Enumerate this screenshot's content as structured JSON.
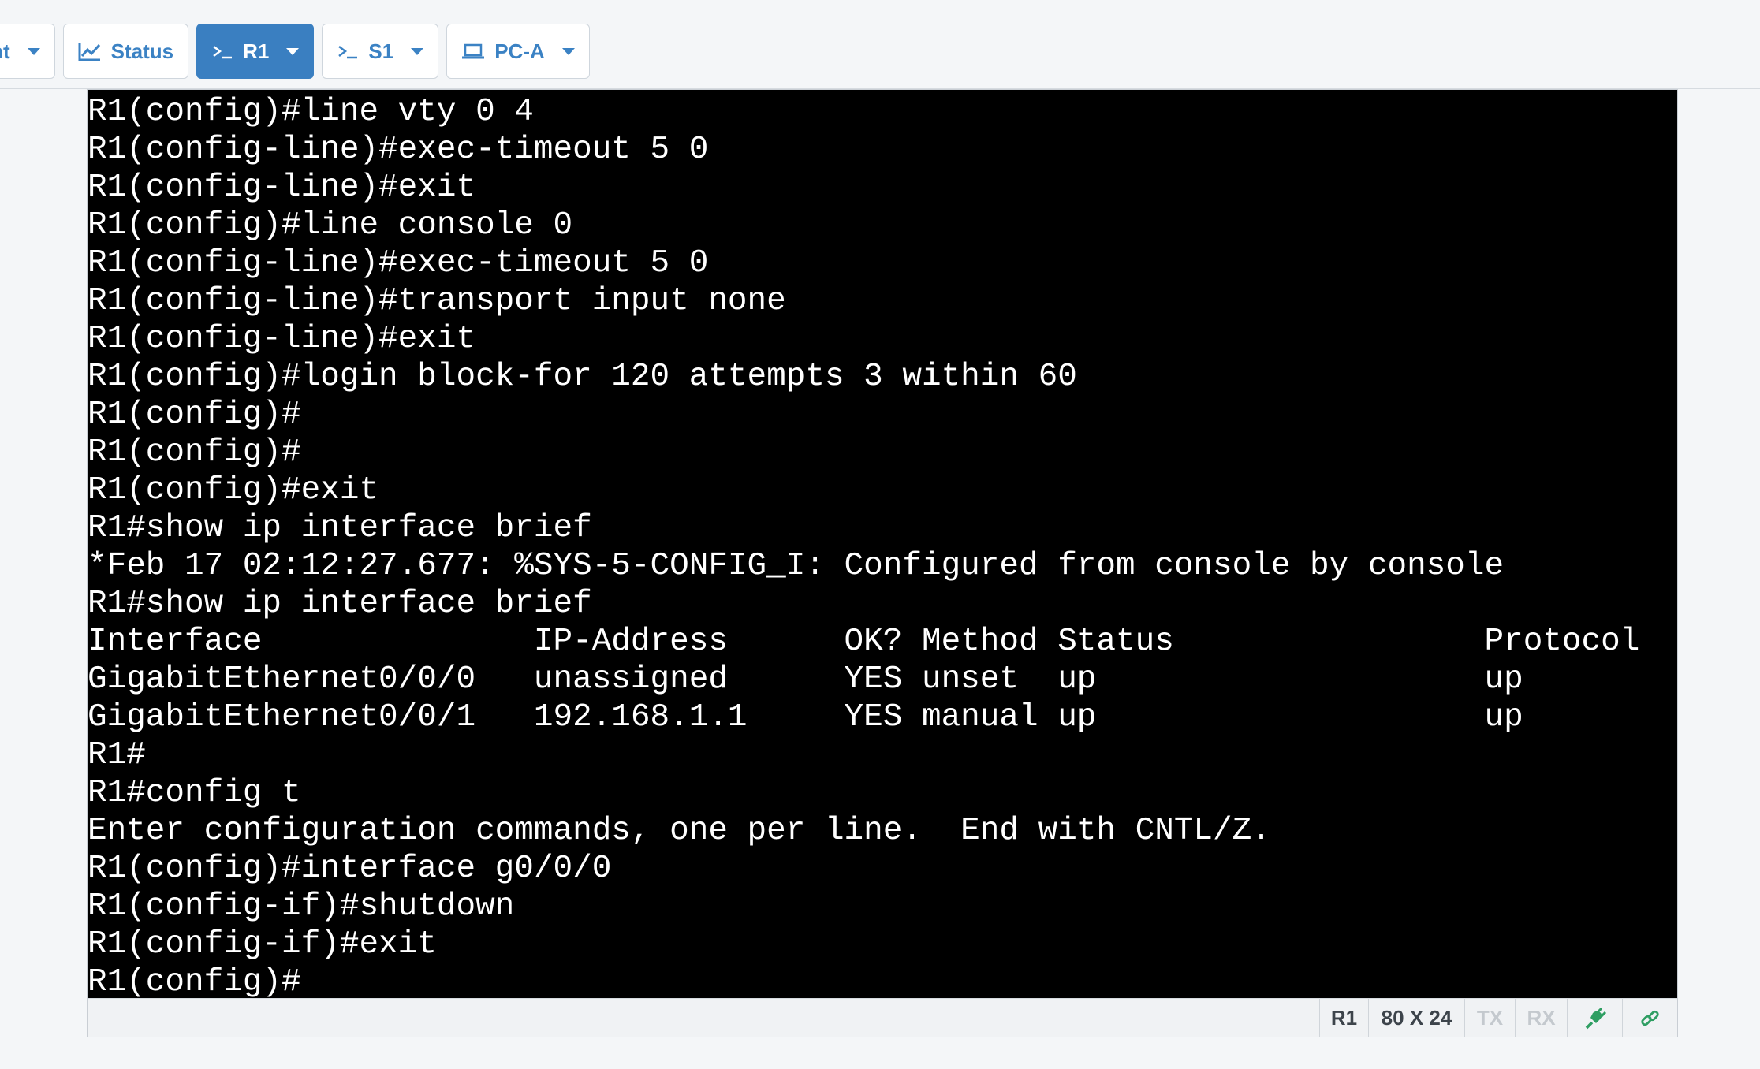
{
  "tabs": [
    {
      "label": "tent",
      "icon": "document-icon"
    },
    {
      "label": "Status",
      "icon": "chart-line-icon"
    },
    {
      "label": "R1",
      "icon": "terminal-icon"
    },
    {
      "label": "S1",
      "icon": "terminal-icon"
    },
    {
      "label": "PC-A",
      "icon": "laptop-icon"
    }
  ],
  "active_tab": "R1",
  "terminal": {
    "lines": [
      "R1(config)#line vty 0 4",
      "R1(config-line)#exec-timeout 5 0",
      "R1(config-line)#exit",
      "R1(config)#line console 0",
      "R1(config-line)#exec-timeout 5 0",
      "R1(config-line)#transport input none",
      "R1(config-line)#exit",
      "R1(config)#login block-for 120 attempts 3 within 60",
      "R1(config)#",
      "R1(config)#",
      "R1(config)#exit",
      "R1#show ip interface brief",
      "*Feb 17 02:12:27.677: %SYS-5-CONFIG_I: Configured from console by console",
      "R1#show ip interface brief",
      "Interface              IP-Address      OK? Method Status                Protocol",
      "GigabitEthernet0/0/0   unassigned      YES unset  up                    up",
      "GigabitEthernet0/0/1   192.168.1.1     YES manual up                    up",
      "R1#",
      "R1#config t",
      "Enter configuration commands, one per line.  End with CNTL/Z.",
      "R1(config)#interface g0/0/0",
      "R1(config-if)#shutdown",
      "R1(config-if)#exit",
      "R1(config)#"
    ]
  },
  "statusbar": {
    "device": "R1",
    "size": "80 X 24",
    "tx": "TX",
    "rx": "RX",
    "plug_icon": "plug-icon",
    "link_icon": "link-icon",
    "accent_color": "#2e9e62"
  }
}
